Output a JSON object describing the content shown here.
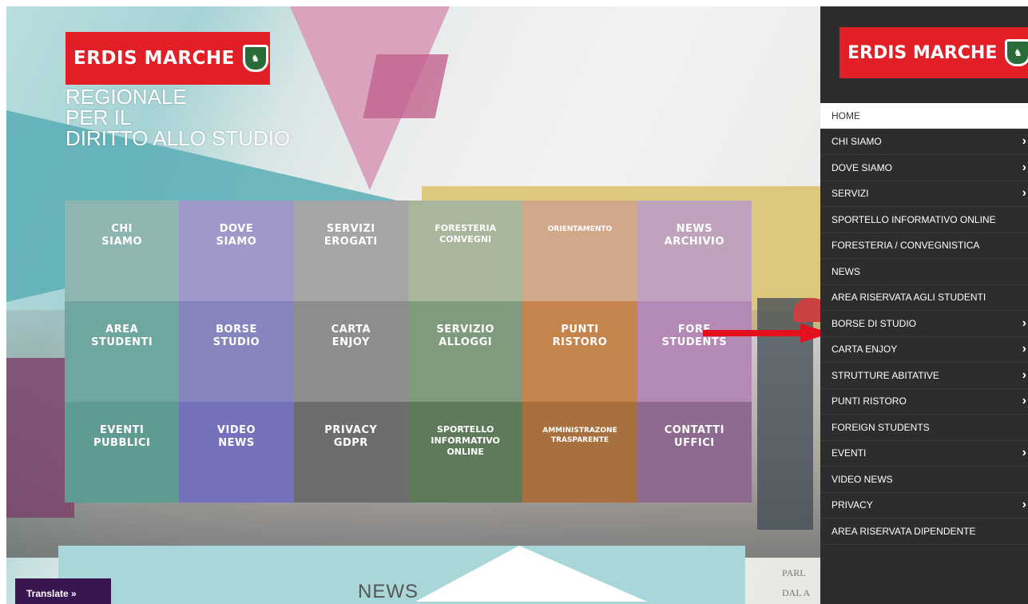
{
  "site": {
    "logo_text": "ERDIS MARCHE",
    "subtitle": [
      "REGIONALE",
      "PER IL",
      "DIRITTO ALLO STUDIO"
    ]
  },
  "tiles": [
    {
      "label": "CHI\nSIAMO",
      "color": "#8fb5b1",
      "size": "normal"
    },
    {
      "label": "DOVE\nSIAMO",
      "color": "#9e99c8",
      "size": "normal"
    },
    {
      "label": "SERVIZI\nEROGATI",
      "color": "#a5a5a5",
      "size": "normal"
    },
    {
      "label": "FORESTERIA\nCONVEGNI",
      "color": "#a8b69b",
      "size": "tight"
    },
    {
      "label": "ORIENTAMENTO",
      "color": "#d1a98a",
      "size": "small"
    },
    {
      "label": "NEWS\nARCHIVIO",
      "color": "#bfa3bd",
      "size": "normal"
    },
    {
      "label": "AREA\nSTUDENTI",
      "color": "#6fa69f",
      "size": "normal"
    },
    {
      "label": "BORSE\nSTUDIO",
      "color": "#8785bd",
      "size": "normal"
    },
    {
      "label": "CARTA\nENJOY",
      "color": "#8d8d8d",
      "size": "normal"
    },
    {
      "label": "SERVIZIO\nALLOGGI",
      "color": "#7f9a7c",
      "size": "normal"
    },
    {
      "label": "PUNTI\nRISTORO",
      "color": "#c5844c",
      "size": "normal"
    },
    {
      "label": "FORE\nSTUDENTS",
      "color": "#b489b5",
      "size": "normal"
    },
    {
      "label": "EVENTI\nPUBBLICI",
      "color": "#5f9a93",
      "size": "normal"
    },
    {
      "label": "VIDEO\nNEWS",
      "color": "#7671bd",
      "size": "normal"
    },
    {
      "label": "PRIVACY\nGDPR",
      "color": "#6d6d6d",
      "size": "normal"
    },
    {
      "label": "SPORTELLO\nINFORMATIVO\nONLINE",
      "color": "#5f7a5b",
      "size": "tight"
    },
    {
      "label": "AMMINISTRAZONE\nTRASPARENTE",
      "color": "#a8703e",
      "size": "small"
    },
    {
      "label": "CONTATTI\nUFFICI",
      "color": "#8e6a90",
      "size": "normal"
    }
  ],
  "news": {
    "title": "NEWS",
    "side_text": [
      "PARL",
      "DAL A"
    ]
  },
  "translate_label": "Translate »",
  "menu": {
    "logo_text": "ERDIS MARCHE",
    "items": [
      {
        "label": "HOME",
        "has_submenu": false,
        "active": true
      },
      {
        "label": "CHI SIAMO",
        "has_submenu": true
      },
      {
        "label": "DOVE SIAMO",
        "has_submenu": true
      },
      {
        "label": "SERVIZI",
        "has_submenu": true
      },
      {
        "label": "SPORTELLO INFORMATIVO ONLINE",
        "has_submenu": false
      },
      {
        "label": "FORESTERIA / CONVEGNISTICA",
        "has_submenu": false
      },
      {
        "label": "NEWS",
        "has_submenu": false
      },
      {
        "label": "AREA RISERVATA AGLI STUDENTI",
        "has_submenu": false
      },
      {
        "label": "BORSE DI STUDIO",
        "has_submenu": true
      },
      {
        "label": "CARTA ENJOY",
        "has_submenu": true
      },
      {
        "label": "STRUTTURE ABITATIVE",
        "has_submenu": true
      },
      {
        "label": "PUNTI RISTORO",
        "has_submenu": true
      },
      {
        "label": "FOREIGN STUDENTS",
        "has_submenu": false
      },
      {
        "label": "EVENTI",
        "has_submenu": true
      },
      {
        "label": "VIDEO NEWS",
        "has_submenu": false
      },
      {
        "label": "PRIVACY",
        "has_submenu": true
      },
      {
        "label": "AREA RISERVATA DIPENDENTE",
        "has_submenu": false
      }
    ]
  },
  "colors": {
    "brand_red": "#e21e26",
    "menu_bg": "#2d2d2d",
    "arrow_red": "#e3101d",
    "translate_bg": "#3a1650"
  }
}
